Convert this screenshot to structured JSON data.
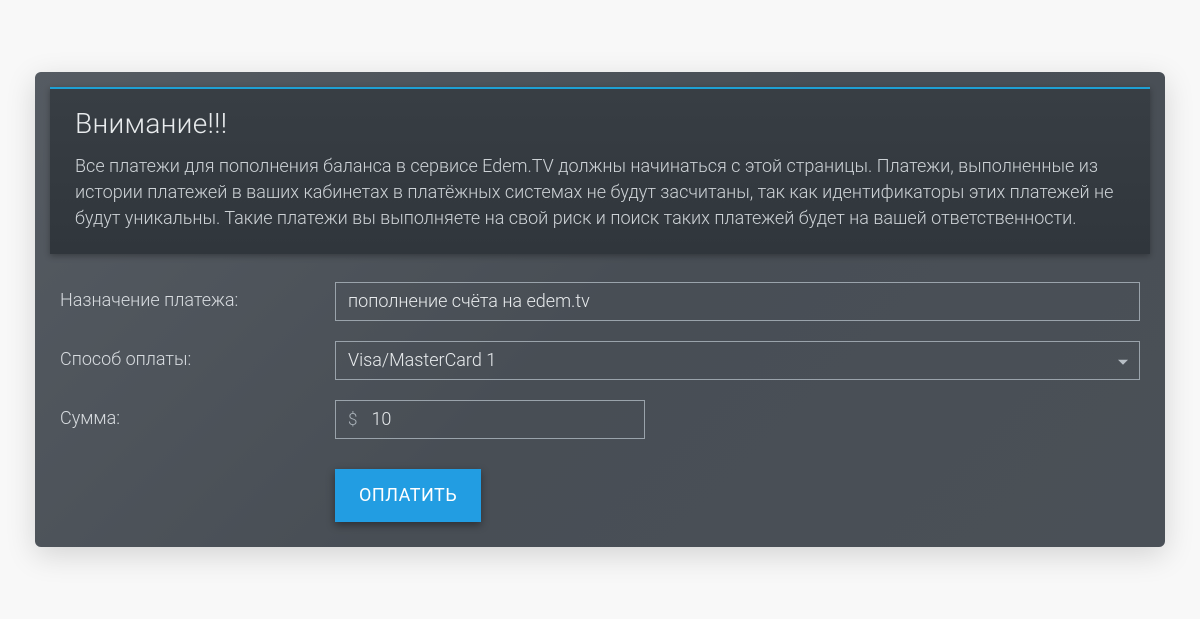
{
  "warning": {
    "title": "Внимание!!!",
    "text": "Все платежи для пополнения баланса в сервисе Edem.TV должны начинаться с этой страницы. Платежи, выполненные из истории платежей в ваших кабинетах в платёжных системах не будут засчитаны, так как идентификаторы этих платежей не будут уникальны. Такие платежи вы выполняете на свой риск и поиск таких платежей будет на вашей ответственности."
  },
  "form": {
    "purpose": {
      "label": "Назначение платежа:",
      "value": "пополнение счёта на edem.tv"
    },
    "paymentMethod": {
      "label": "Способ оплаты:",
      "selected": "Visa/MasterCard 1"
    },
    "amount": {
      "label": "Сумма:",
      "currency": "$",
      "value": "10"
    },
    "submitLabel": "ОПЛАТИТЬ"
  },
  "colors": {
    "accent": "#229de2",
    "borderTop": "#1ea0d4"
  }
}
